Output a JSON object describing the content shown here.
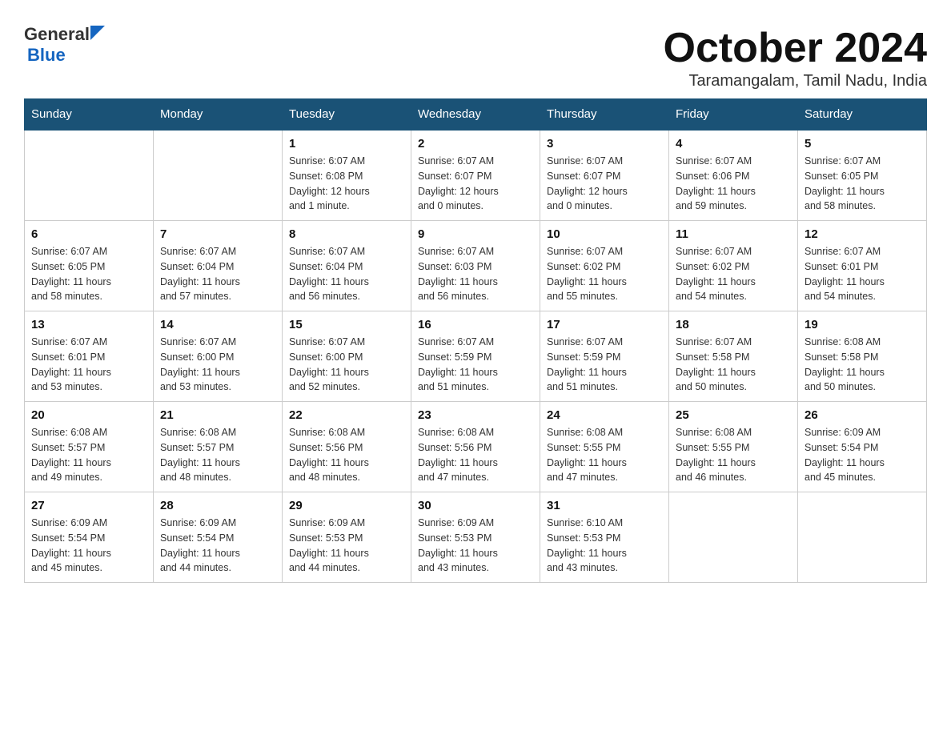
{
  "header": {
    "logo_general": "General",
    "logo_blue": "Blue",
    "month_title": "October 2024",
    "location": "Taramangalam, Tamil Nadu, India"
  },
  "weekdays": [
    "Sunday",
    "Monday",
    "Tuesday",
    "Wednesday",
    "Thursday",
    "Friday",
    "Saturday"
  ],
  "weeks": [
    [
      {
        "day": "",
        "info": ""
      },
      {
        "day": "",
        "info": ""
      },
      {
        "day": "1",
        "info": "Sunrise: 6:07 AM\nSunset: 6:08 PM\nDaylight: 12 hours\nand 1 minute."
      },
      {
        "day": "2",
        "info": "Sunrise: 6:07 AM\nSunset: 6:07 PM\nDaylight: 12 hours\nand 0 minutes."
      },
      {
        "day": "3",
        "info": "Sunrise: 6:07 AM\nSunset: 6:07 PM\nDaylight: 12 hours\nand 0 minutes."
      },
      {
        "day": "4",
        "info": "Sunrise: 6:07 AM\nSunset: 6:06 PM\nDaylight: 11 hours\nand 59 minutes."
      },
      {
        "day": "5",
        "info": "Sunrise: 6:07 AM\nSunset: 6:05 PM\nDaylight: 11 hours\nand 58 minutes."
      }
    ],
    [
      {
        "day": "6",
        "info": "Sunrise: 6:07 AM\nSunset: 6:05 PM\nDaylight: 11 hours\nand 58 minutes."
      },
      {
        "day": "7",
        "info": "Sunrise: 6:07 AM\nSunset: 6:04 PM\nDaylight: 11 hours\nand 57 minutes."
      },
      {
        "day": "8",
        "info": "Sunrise: 6:07 AM\nSunset: 6:04 PM\nDaylight: 11 hours\nand 56 minutes."
      },
      {
        "day": "9",
        "info": "Sunrise: 6:07 AM\nSunset: 6:03 PM\nDaylight: 11 hours\nand 56 minutes."
      },
      {
        "day": "10",
        "info": "Sunrise: 6:07 AM\nSunset: 6:02 PM\nDaylight: 11 hours\nand 55 minutes."
      },
      {
        "day": "11",
        "info": "Sunrise: 6:07 AM\nSunset: 6:02 PM\nDaylight: 11 hours\nand 54 minutes."
      },
      {
        "day": "12",
        "info": "Sunrise: 6:07 AM\nSunset: 6:01 PM\nDaylight: 11 hours\nand 54 minutes."
      }
    ],
    [
      {
        "day": "13",
        "info": "Sunrise: 6:07 AM\nSunset: 6:01 PM\nDaylight: 11 hours\nand 53 minutes."
      },
      {
        "day": "14",
        "info": "Sunrise: 6:07 AM\nSunset: 6:00 PM\nDaylight: 11 hours\nand 53 minutes."
      },
      {
        "day": "15",
        "info": "Sunrise: 6:07 AM\nSunset: 6:00 PM\nDaylight: 11 hours\nand 52 minutes."
      },
      {
        "day": "16",
        "info": "Sunrise: 6:07 AM\nSunset: 5:59 PM\nDaylight: 11 hours\nand 51 minutes."
      },
      {
        "day": "17",
        "info": "Sunrise: 6:07 AM\nSunset: 5:59 PM\nDaylight: 11 hours\nand 51 minutes."
      },
      {
        "day": "18",
        "info": "Sunrise: 6:07 AM\nSunset: 5:58 PM\nDaylight: 11 hours\nand 50 minutes."
      },
      {
        "day": "19",
        "info": "Sunrise: 6:08 AM\nSunset: 5:58 PM\nDaylight: 11 hours\nand 50 minutes."
      }
    ],
    [
      {
        "day": "20",
        "info": "Sunrise: 6:08 AM\nSunset: 5:57 PM\nDaylight: 11 hours\nand 49 minutes."
      },
      {
        "day": "21",
        "info": "Sunrise: 6:08 AM\nSunset: 5:57 PM\nDaylight: 11 hours\nand 48 minutes."
      },
      {
        "day": "22",
        "info": "Sunrise: 6:08 AM\nSunset: 5:56 PM\nDaylight: 11 hours\nand 48 minutes."
      },
      {
        "day": "23",
        "info": "Sunrise: 6:08 AM\nSunset: 5:56 PM\nDaylight: 11 hours\nand 47 minutes."
      },
      {
        "day": "24",
        "info": "Sunrise: 6:08 AM\nSunset: 5:55 PM\nDaylight: 11 hours\nand 47 minutes."
      },
      {
        "day": "25",
        "info": "Sunrise: 6:08 AM\nSunset: 5:55 PM\nDaylight: 11 hours\nand 46 minutes."
      },
      {
        "day": "26",
        "info": "Sunrise: 6:09 AM\nSunset: 5:54 PM\nDaylight: 11 hours\nand 45 minutes."
      }
    ],
    [
      {
        "day": "27",
        "info": "Sunrise: 6:09 AM\nSunset: 5:54 PM\nDaylight: 11 hours\nand 45 minutes."
      },
      {
        "day": "28",
        "info": "Sunrise: 6:09 AM\nSunset: 5:54 PM\nDaylight: 11 hours\nand 44 minutes."
      },
      {
        "day": "29",
        "info": "Sunrise: 6:09 AM\nSunset: 5:53 PM\nDaylight: 11 hours\nand 44 minutes."
      },
      {
        "day": "30",
        "info": "Sunrise: 6:09 AM\nSunset: 5:53 PM\nDaylight: 11 hours\nand 43 minutes."
      },
      {
        "day": "31",
        "info": "Sunrise: 6:10 AM\nSunset: 5:53 PM\nDaylight: 11 hours\nand 43 minutes."
      },
      {
        "day": "",
        "info": ""
      },
      {
        "day": "",
        "info": ""
      }
    ]
  ]
}
